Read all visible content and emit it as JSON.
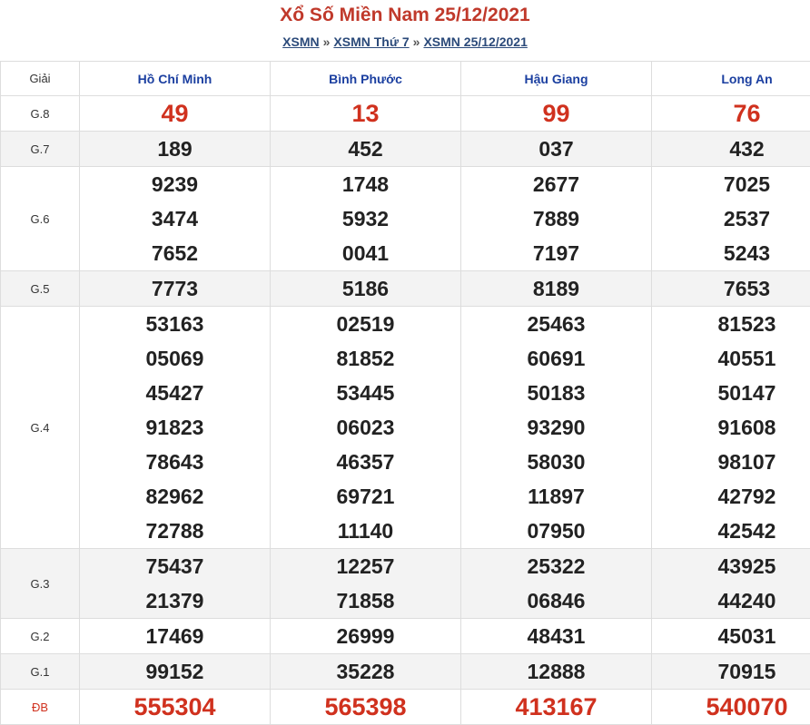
{
  "header": {
    "title": "Xổ Số Miền Nam 25/12/2021",
    "breadcrumbs": [
      "XSMN",
      "XSMN Thứ 7",
      "XSMN 25/12/2021"
    ],
    "separator": "»"
  },
  "table": {
    "prize_header": "Giải",
    "provinces": [
      "Hồ Chí Minh",
      "Bình Phước",
      "Hậu Giang",
      "Long An"
    ],
    "rows": [
      {
        "prize": "G.8",
        "shade": false,
        "highlight": true,
        "values": [
          [
            "49"
          ],
          [
            "13"
          ],
          [
            "99"
          ],
          [
            "76"
          ]
        ]
      },
      {
        "prize": "G.7",
        "shade": true,
        "highlight": false,
        "values": [
          [
            "189"
          ],
          [
            "452"
          ],
          [
            "037"
          ],
          [
            "432"
          ]
        ]
      },
      {
        "prize": "G.6",
        "shade": false,
        "highlight": false,
        "values": [
          [
            "9239",
            "3474",
            "7652"
          ],
          [
            "1748",
            "5932",
            "0041"
          ],
          [
            "2677",
            "7889",
            "7197"
          ],
          [
            "7025",
            "2537",
            "5243"
          ]
        ]
      },
      {
        "prize": "G.5",
        "shade": true,
        "highlight": false,
        "values": [
          [
            "7773"
          ],
          [
            "5186"
          ],
          [
            "8189"
          ],
          [
            "7653"
          ]
        ]
      },
      {
        "prize": "G.4",
        "shade": false,
        "highlight": false,
        "values": [
          [
            "53163",
            "05069",
            "45427",
            "91823",
            "78643",
            "82962",
            "72788"
          ],
          [
            "02519",
            "81852",
            "53445",
            "06023",
            "46357",
            "69721",
            "11140"
          ],
          [
            "25463",
            "60691",
            "50183",
            "93290",
            "58030",
            "11897",
            "07950"
          ],
          [
            "81523",
            "40551",
            "50147",
            "91608",
            "98107",
            "42792",
            "42542"
          ]
        ]
      },
      {
        "prize": "G.3",
        "shade": true,
        "highlight": false,
        "values": [
          [
            "75437",
            "21379"
          ],
          [
            "12257",
            "71858"
          ],
          [
            "25322",
            "06846"
          ],
          [
            "43925",
            "44240"
          ]
        ]
      },
      {
        "prize": "G.2",
        "shade": false,
        "highlight": false,
        "values": [
          [
            "17469"
          ],
          [
            "26999"
          ],
          [
            "48431"
          ],
          [
            "45031"
          ]
        ]
      },
      {
        "prize": "G.1",
        "shade": true,
        "highlight": false,
        "values": [
          [
            "99152"
          ],
          [
            "35228"
          ],
          [
            "12888"
          ],
          [
            "70915"
          ]
        ]
      },
      {
        "prize": "ĐB",
        "shade": false,
        "highlight": true,
        "db": true,
        "values": [
          [
            "555304"
          ],
          [
            "565398"
          ],
          [
            "413167"
          ],
          [
            "540070"
          ]
        ]
      }
    ]
  },
  "colors": {
    "title": "#c0392b",
    "highlight": "#d0311e",
    "province": "#1b3fa0",
    "link": "#2b4a7a"
  }
}
